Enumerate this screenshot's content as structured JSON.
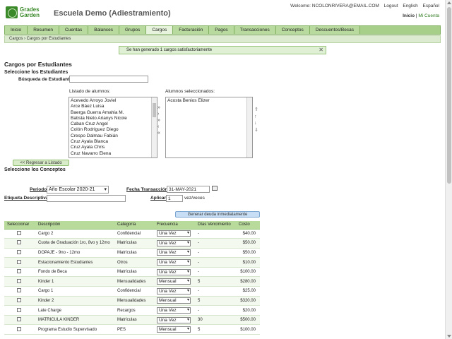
{
  "logo": {
    "line1": "Grades",
    "line2": "Garden"
  },
  "school_name": "Escuela Demo (Adiestramiento)",
  "top_links": {
    "welcome": "Welcome: NCOLONRIVERA@EMAIL.COM",
    "logout": "Logout",
    "english": "English",
    "espanol": "Español",
    "inicio": "Inicio",
    "separator": "|",
    "mi_cuenta": "Mi Cuenta"
  },
  "nav": [
    "Inicio",
    "Resumen",
    "Cuentas",
    "Balances",
    "Grupos",
    "Cargos",
    "Facturación",
    "Pagos",
    "Transacciones",
    "Conceptos",
    "Descuentos/Becas"
  ],
  "breadcrumb": "Cargos  ›  Cargos por Estudiantes",
  "notice": "Se han generado 1 cargos satisfactoriamente",
  "page_title": "Cargos por Estudiantes",
  "select_students_title": "Seleccione los Estudiantes",
  "search_label": "Búsqueda de Estudiante",
  "list_label": "Listado de alumnos:",
  "selected_label": "Alumnos seleccionados:",
  "students": [
    "Acevedo Arroyo Joviel",
    "Arce Báez Luisa",
    "Baerga Guerra Amahia M.",
    "Batista Nieto Arianys Nicole",
    "Caban Cruz Angel",
    "Colón Rodríguez Diego",
    "Crespo Dalmau Fabián",
    "Cruz Ayala Blanca",
    "Cruz Ayala Chris",
    "Cruz Navarro Elena"
  ],
  "selected_students": [
    "Acosta Benios Elizer"
  ],
  "back_button": "<< Regresar a Listado",
  "select_concepts_title": "Seleccione los Conceptos",
  "periodo_label": "Periodo",
  "periodo_value": "Año Escolar 2020-21",
  "fecha_label": "Fecha Transacción",
  "fecha_value": "31-MAY-2021",
  "etiqueta_label": "Etiqueta Descriptiva",
  "aplicar_label": "Aplicar",
  "aplicar_value": "1",
  "veces_label": "vez/veces",
  "generate_button": "Generar deuda inmediatamente",
  "table": {
    "headers": [
      "Seleccionar",
      "Descripción",
      "Categoría",
      "Frecuencia",
      "Días Vencimiento",
      "Costo"
    ],
    "rows": [
      [
        "Cargo 2",
        "Confidencial",
        "Una Vez",
        "-",
        "$40.00"
      ],
      [
        "Cuota de Graduación 1ro, 8vo y 12mo",
        "Matrículas",
        "Una Vez",
        "-",
        "$50.00"
      ],
      [
        "DOPAJE - 9no - 12mo",
        "Matrículas",
        "Una Vez",
        "-",
        "$50.00"
      ],
      [
        "Estacionamiento Estudiantes",
        "Otros",
        "Una Vez",
        "-",
        "$10.00"
      ],
      [
        "Fondo de Beca",
        "Matrículas",
        "Una Vez",
        "-",
        "$100.00"
      ],
      [
        "Kinder 1",
        "Mensualidades",
        "Mensual",
        "5",
        "$280.00"
      ],
      [
        "Cargo 1",
        "Confidencial",
        "Una Vez",
        "-",
        "$25.00"
      ],
      [
        "Kinder 2",
        "Mensualidades",
        "Mensual",
        "5",
        "$320.00"
      ],
      [
        "Late Charge",
        "Recargos",
        "Una Vez",
        "-",
        "$20.00"
      ],
      [
        "MATRICULA KINDER",
        "Matrículas",
        "Una Vez",
        "30",
        "$500.00"
      ],
      [
        "Programa Estudio Supervisado",
        "PES",
        "Mensual",
        "5",
        "$100.00"
      ]
    ]
  }
}
